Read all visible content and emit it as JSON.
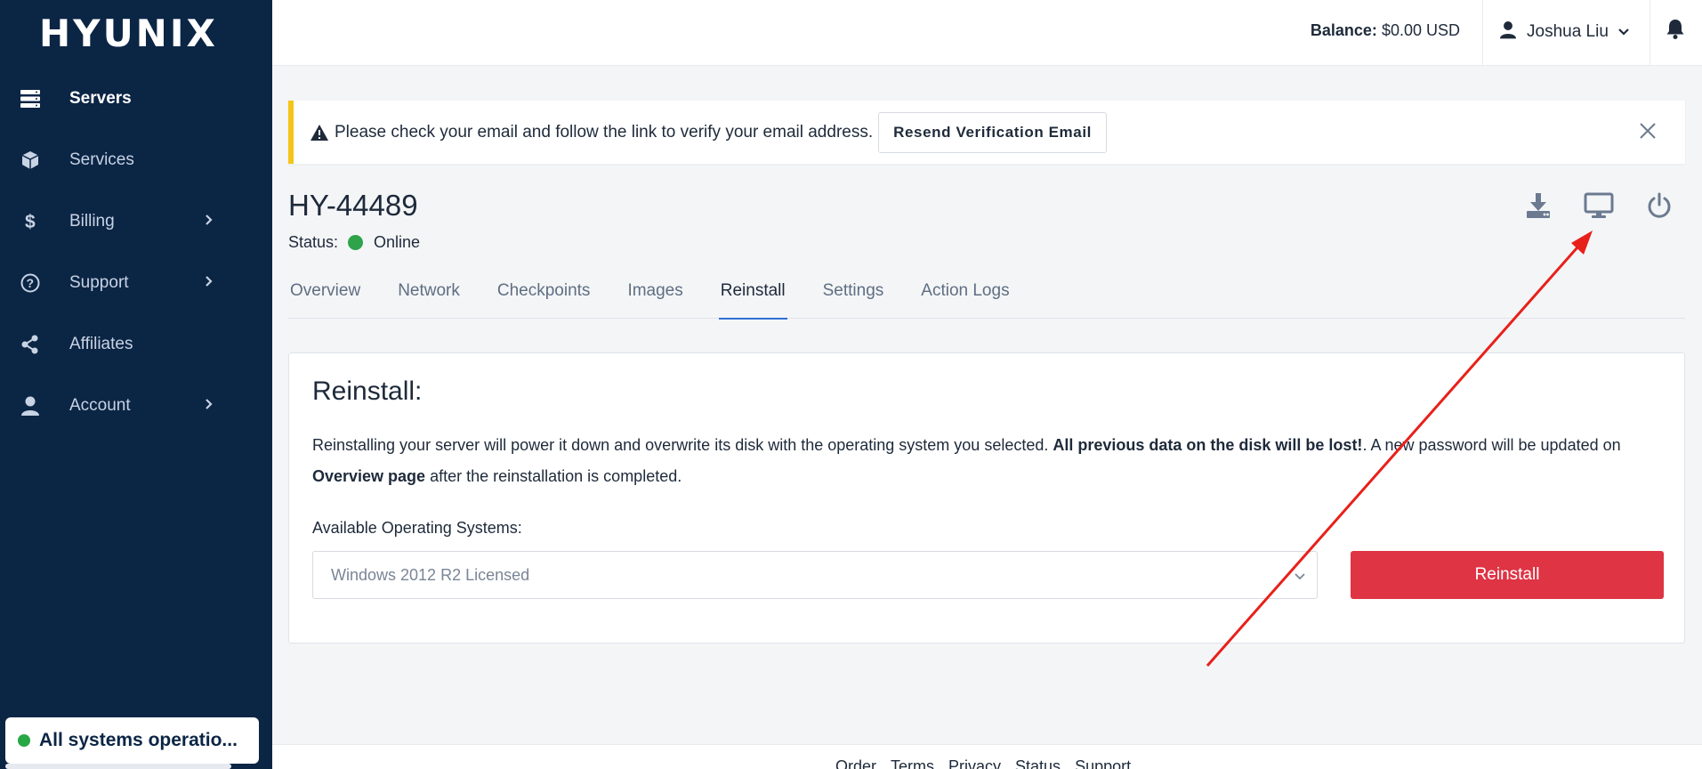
{
  "brand": {
    "logo_text": "HYUNIX"
  },
  "sidebar": {
    "items": [
      {
        "label": "Servers",
        "icon": "servers-icon",
        "has_submenu": false,
        "active": true
      },
      {
        "label": "Services",
        "icon": "box-icon",
        "has_submenu": false,
        "active": false
      },
      {
        "label": "Billing",
        "icon": "dollar-icon",
        "has_submenu": true,
        "active": false
      },
      {
        "label": "Support",
        "icon": "question-circle-icon",
        "has_submenu": true,
        "active": false
      },
      {
        "label": "Affiliates",
        "icon": "share-icon",
        "has_submenu": false,
        "active": false
      },
      {
        "label": "Account",
        "icon": "user-icon",
        "has_submenu": true,
        "active": false
      }
    ],
    "system_status": "All systems operatio..."
  },
  "topbar": {
    "balance_label": "Balance:",
    "balance_value": "$0.00 USD",
    "user_name": "Joshua Liu"
  },
  "alert": {
    "message": "Please check your email and follow the link to verify your email address.",
    "button_label": "Resend Verification Email"
  },
  "server": {
    "id": "HY-44489",
    "status_label": "Status:",
    "status_value": "Online"
  },
  "tabs": [
    {
      "label": "Overview",
      "active": false
    },
    {
      "label": "Network",
      "active": false
    },
    {
      "label": "Checkpoints",
      "active": false
    },
    {
      "label": "Images",
      "active": false
    },
    {
      "label": "Reinstall",
      "active": true
    },
    {
      "label": "Settings",
      "active": false
    },
    {
      "label": "Action Logs",
      "active": false
    }
  ],
  "reinstall": {
    "title": "Reinstall:",
    "desc_part1": "Reinstalling your server will power it down and overwrite its disk with the operating system you selected. ",
    "desc_bold1": "All previous data on the disk will be lost!",
    "desc_part2": ". A new password will be updated on ",
    "desc_bold2": "Overview page",
    "desc_part3": " after the reinstallation is completed.",
    "os_label": "Available Operating Systems:",
    "os_selected": "Windows 2012 R2 Licensed",
    "button_label": "Reinstall"
  },
  "footer": {
    "links": [
      "Order",
      "Terms",
      "Privacy",
      "Status",
      "Support"
    ]
  },
  "colors": {
    "sidebar_bg": "#0b2545",
    "danger": "#de3444",
    "warning_border": "#f5c518",
    "online": "#2ea34a",
    "annotation_arrow": "#e8201a"
  }
}
